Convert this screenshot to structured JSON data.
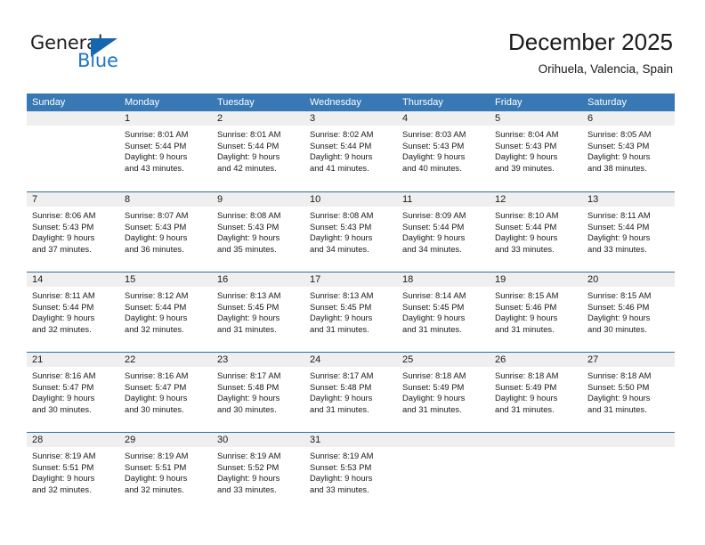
{
  "brand": {
    "name_part1": "General",
    "name_part2": "Blue",
    "triangle_color": "#1566ae",
    "blue_color": "#2077bc"
  },
  "header": {
    "month_title": "December 2025",
    "location": "Orihuela, Valencia, Spain"
  },
  "theme": {
    "header_row_bg": "#3878b4",
    "day_band_bg": "#efefef",
    "row_divider": "#2f6fa8",
    "text": "#1a1a1a"
  },
  "weekdays": [
    "Sunday",
    "Monday",
    "Tuesday",
    "Wednesday",
    "Thursday",
    "Friday",
    "Saturday"
  ],
  "weeks": [
    [
      {
        "day": "",
        "sunrise": "",
        "sunset": "",
        "daylight_line1": "",
        "daylight_line2": "",
        "empty": true
      },
      {
        "day": "1",
        "sunrise": "Sunrise: 8:01 AM",
        "sunset": "Sunset: 5:44 PM",
        "daylight_line1": "Daylight: 9 hours",
        "daylight_line2": "and 43 minutes."
      },
      {
        "day": "2",
        "sunrise": "Sunrise: 8:01 AM",
        "sunset": "Sunset: 5:44 PM",
        "daylight_line1": "Daylight: 9 hours",
        "daylight_line2": "and 42 minutes."
      },
      {
        "day": "3",
        "sunrise": "Sunrise: 8:02 AM",
        "sunset": "Sunset: 5:44 PM",
        "daylight_line1": "Daylight: 9 hours",
        "daylight_line2": "and 41 minutes."
      },
      {
        "day": "4",
        "sunrise": "Sunrise: 8:03 AM",
        "sunset": "Sunset: 5:43 PM",
        "daylight_line1": "Daylight: 9 hours",
        "daylight_line2": "and 40 minutes."
      },
      {
        "day": "5",
        "sunrise": "Sunrise: 8:04 AM",
        "sunset": "Sunset: 5:43 PM",
        "daylight_line1": "Daylight: 9 hours",
        "daylight_line2": "and 39 minutes."
      },
      {
        "day": "6",
        "sunrise": "Sunrise: 8:05 AM",
        "sunset": "Sunset: 5:43 PM",
        "daylight_line1": "Daylight: 9 hours",
        "daylight_line2": "and 38 minutes."
      }
    ],
    [
      {
        "day": "7",
        "sunrise": "Sunrise: 8:06 AM",
        "sunset": "Sunset: 5:43 PM",
        "daylight_line1": "Daylight: 9 hours",
        "daylight_line2": "and 37 minutes."
      },
      {
        "day": "8",
        "sunrise": "Sunrise: 8:07 AM",
        "sunset": "Sunset: 5:43 PM",
        "daylight_line1": "Daylight: 9 hours",
        "daylight_line2": "and 36 minutes."
      },
      {
        "day": "9",
        "sunrise": "Sunrise: 8:08 AM",
        "sunset": "Sunset: 5:43 PM",
        "daylight_line1": "Daylight: 9 hours",
        "daylight_line2": "and 35 minutes."
      },
      {
        "day": "10",
        "sunrise": "Sunrise: 8:08 AM",
        "sunset": "Sunset: 5:43 PM",
        "daylight_line1": "Daylight: 9 hours",
        "daylight_line2": "and 34 minutes."
      },
      {
        "day": "11",
        "sunrise": "Sunrise: 8:09 AM",
        "sunset": "Sunset: 5:44 PM",
        "daylight_line1": "Daylight: 9 hours",
        "daylight_line2": "and 34 minutes."
      },
      {
        "day": "12",
        "sunrise": "Sunrise: 8:10 AM",
        "sunset": "Sunset: 5:44 PM",
        "daylight_line1": "Daylight: 9 hours",
        "daylight_line2": "and 33 minutes."
      },
      {
        "day": "13",
        "sunrise": "Sunrise: 8:11 AM",
        "sunset": "Sunset: 5:44 PM",
        "daylight_line1": "Daylight: 9 hours",
        "daylight_line2": "and 33 minutes."
      }
    ],
    [
      {
        "day": "14",
        "sunrise": "Sunrise: 8:11 AM",
        "sunset": "Sunset: 5:44 PM",
        "daylight_line1": "Daylight: 9 hours",
        "daylight_line2": "and 32 minutes."
      },
      {
        "day": "15",
        "sunrise": "Sunrise: 8:12 AM",
        "sunset": "Sunset: 5:44 PM",
        "daylight_line1": "Daylight: 9 hours",
        "daylight_line2": "and 32 minutes."
      },
      {
        "day": "16",
        "sunrise": "Sunrise: 8:13 AM",
        "sunset": "Sunset: 5:45 PM",
        "daylight_line1": "Daylight: 9 hours",
        "daylight_line2": "and 31 minutes."
      },
      {
        "day": "17",
        "sunrise": "Sunrise: 8:13 AM",
        "sunset": "Sunset: 5:45 PM",
        "daylight_line1": "Daylight: 9 hours",
        "daylight_line2": "and 31 minutes."
      },
      {
        "day": "18",
        "sunrise": "Sunrise: 8:14 AM",
        "sunset": "Sunset: 5:45 PM",
        "daylight_line1": "Daylight: 9 hours",
        "daylight_line2": "and 31 minutes."
      },
      {
        "day": "19",
        "sunrise": "Sunrise: 8:15 AM",
        "sunset": "Sunset: 5:46 PM",
        "daylight_line1": "Daylight: 9 hours",
        "daylight_line2": "and 31 minutes."
      },
      {
        "day": "20",
        "sunrise": "Sunrise: 8:15 AM",
        "sunset": "Sunset: 5:46 PM",
        "daylight_line1": "Daylight: 9 hours",
        "daylight_line2": "and 30 minutes."
      }
    ],
    [
      {
        "day": "21",
        "sunrise": "Sunrise: 8:16 AM",
        "sunset": "Sunset: 5:47 PM",
        "daylight_line1": "Daylight: 9 hours",
        "daylight_line2": "and 30 minutes."
      },
      {
        "day": "22",
        "sunrise": "Sunrise: 8:16 AM",
        "sunset": "Sunset: 5:47 PM",
        "daylight_line1": "Daylight: 9 hours",
        "daylight_line2": "and 30 minutes."
      },
      {
        "day": "23",
        "sunrise": "Sunrise: 8:17 AM",
        "sunset": "Sunset: 5:48 PM",
        "daylight_line1": "Daylight: 9 hours",
        "daylight_line2": "and 30 minutes."
      },
      {
        "day": "24",
        "sunrise": "Sunrise: 8:17 AM",
        "sunset": "Sunset: 5:48 PM",
        "daylight_line1": "Daylight: 9 hours",
        "daylight_line2": "and 31 minutes."
      },
      {
        "day": "25",
        "sunrise": "Sunrise: 8:18 AM",
        "sunset": "Sunset: 5:49 PM",
        "daylight_line1": "Daylight: 9 hours",
        "daylight_line2": "and 31 minutes."
      },
      {
        "day": "26",
        "sunrise": "Sunrise: 8:18 AM",
        "sunset": "Sunset: 5:49 PM",
        "daylight_line1": "Daylight: 9 hours",
        "daylight_line2": "and 31 minutes."
      },
      {
        "day": "27",
        "sunrise": "Sunrise: 8:18 AM",
        "sunset": "Sunset: 5:50 PM",
        "daylight_line1": "Daylight: 9 hours",
        "daylight_line2": "and 31 minutes."
      }
    ],
    [
      {
        "day": "28",
        "sunrise": "Sunrise: 8:19 AM",
        "sunset": "Sunset: 5:51 PM",
        "daylight_line1": "Daylight: 9 hours",
        "daylight_line2": "and 32 minutes."
      },
      {
        "day": "29",
        "sunrise": "Sunrise: 8:19 AM",
        "sunset": "Sunset: 5:51 PM",
        "daylight_line1": "Daylight: 9 hours",
        "daylight_line2": "and 32 minutes."
      },
      {
        "day": "30",
        "sunrise": "Sunrise: 8:19 AM",
        "sunset": "Sunset: 5:52 PM",
        "daylight_line1": "Daylight: 9 hours",
        "daylight_line2": "and 33 minutes."
      },
      {
        "day": "31",
        "sunrise": "Sunrise: 8:19 AM",
        "sunset": "Sunset: 5:53 PM",
        "daylight_line1": "Daylight: 9 hours",
        "daylight_line2": "and 33 minutes."
      },
      {
        "day": "",
        "sunrise": "",
        "sunset": "",
        "daylight_line1": "",
        "daylight_line2": "",
        "empty": true
      },
      {
        "day": "",
        "sunrise": "",
        "sunset": "",
        "daylight_line1": "",
        "daylight_line2": "",
        "empty": true
      },
      {
        "day": "",
        "sunrise": "",
        "sunset": "",
        "daylight_line1": "",
        "daylight_line2": "",
        "empty": true
      }
    ]
  ]
}
